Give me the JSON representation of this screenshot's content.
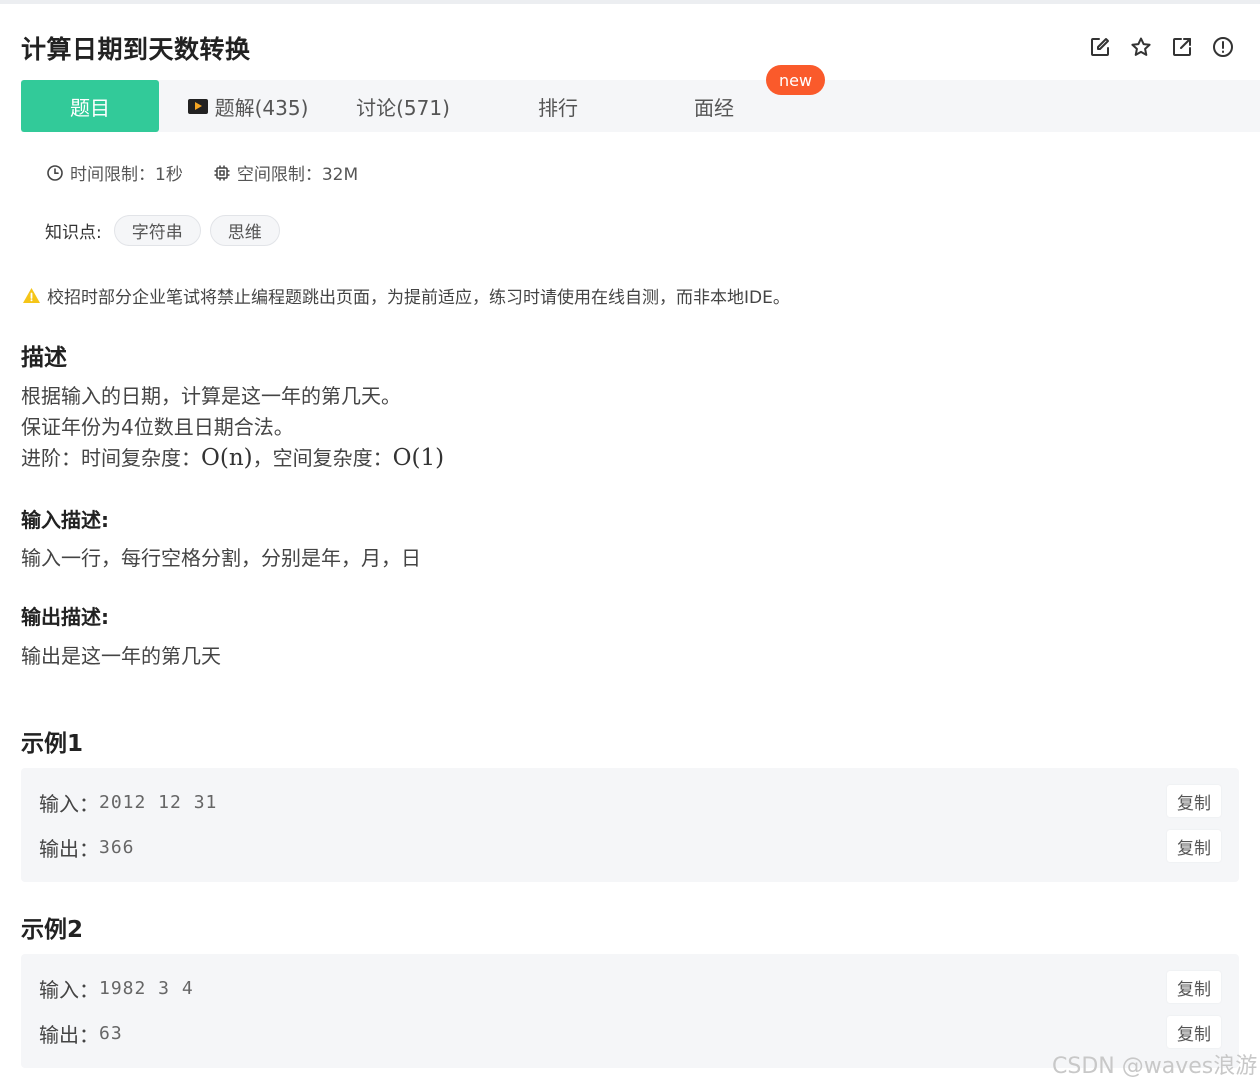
{
  "page_title": "计算日期到天数转换",
  "actions": [
    {
      "icon": "edit-icon"
    },
    {
      "icon": "star-icon"
    },
    {
      "icon": "share-icon"
    },
    {
      "icon": "report-icon"
    }
  ],
  "tabs": [
    {
      "label": "题目",
      "active": true
    },
    {
      "label": "题解(435)",
      "icon": "video-icon"
    },
    {
      "label": "讨论(571)"
    },
    {
      "label": "排行"
    },
    {
      "label": "面经"
    }
  ],
  "new_badge": "new",
  "limits": {
    "time": "时间限制：1秒",
    "space": "空间限制：32M"
  },
  "knowledge": {
    "label": "知识点:",
    "tags": [
      "字符串",
      "思维"
    ]
  },
  "warning": "校招时部分企业笔试将禁止编程题跳出页面，为提前适应，练习时请使用在线自测，而非本地IDE。",
  "description": {
    "heading": "描述",
    "line1": "根据输入的日期，计算是这一年的第几天。",
    "line2": "保证年份为4位数且日期合法。",
    "line3_prefix": "进阶：时间复杂度：",
    "line3_sep": "，空间复杂度：",
    "time_complexity": "O(n)",
    "space_complexity": "O(1)"
  },
  "input_desc": {
    "heading": "输入描述:",
    "text": "输入一行，每行空格分割，分别是年，月，日"
  },
  "output_desc": {
    "heading": "输出描述:",
    "text": "输出是这一年的第几天"
  },
  "examples": [
    {
      "heading": "示例1",
      "input_label": "输入：",
      "input": "2012 12 31",
      "output_label": "输出：",
      "output": "366",
      "copy": "复制"
    },
    {
      "heading": "示例2",
      "input_label": "输入：",
      "input": "1982 3 4",
      "output_label": "输出：",
      "output": "63",
      "copy": "复制"
    }
  ],
  "watermark": "CSDN @waves浪游",
  "colors": {
    "accent": "#32ca99",
    "badge": "#fa5a2b",
    "warning": "#f5c518"
  }
}
